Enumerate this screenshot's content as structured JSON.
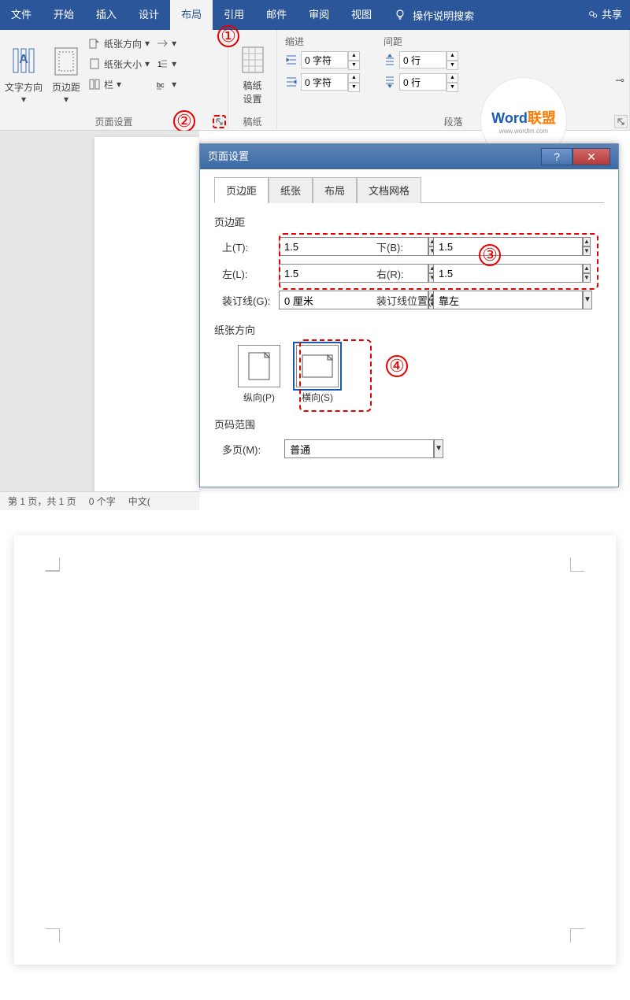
{
  "ribbon": {
    "tabs": [
      "文件",
      "开始",
      "插入",
      "设计",
      "布局",
      "引用",
      "邮件",
      "审阅",
      "视图"
    ],
    "active_index": 4,
    "tell_me": "操作说明搜索",
    "share": "共享"
  },
  "groups": {
    "page_setup": {
      "text_direction": "文字方向",
      "margins": "页边距",
      "orientation": "纸张方向",
      "size": "纸张大小",
      "columns": "栏",
      "breaks": "",
      "line_numbers": "",
      "hyphenation": "",
      "label": "页面设置"
    },
    "manuscript": {
      "btn": "稿纸\n设置",
      "label": "稿纸"
    },
    "paragraph": {
      "label": "段落",
      "indent_label": "缩进",
      "spacing_label": "间距",
      "indent_left": "0 字符",
      "indent_right": "0 字符",
      "spacing_before": "0 行",
      "spacing_after": "0 行"
    }
  },
  "dialog": {
    "title": "页面设置",
    "tabs": [
      "页边距",
      "纸张",
      "布局",
      "文档网格"
    ],
    "active_tab": 0,
    "section_margins": "页边距",
    "top_label": "上(T):",
    "top_val": "1.5",
    "bottom_label": "下(B):",
    "bottom_val": "1.5",
    "left_label": "左(L):",
    "left_val": "1.5",
    "right_label": "右(R):",
    "right_val": "1.5",
    "gutter_label": "装订线(G):",
    "gutter_val": "0 厘米",
    "gutter_pos_label": "装订线位置(U):",
    "gutter_pos_val": "靠左",
    "section_orient": "纸张方向",
    "portrait": "纵向(P)",
    "landscape": "横向(S)",
    "section_pages": "页码范围",
    "multipage_label": "多页(M):",
    "multipage_val": "普通"
  },
  "callouts": {
    "c1": "①",
    "c2": "②",
    "c3": "③",
    "c4": "④"
  },
  "status": {
    "pages": "第 1 页，共 1 页",
    "words": "0 个字",
    "lang": "中文("
  },
  "watermark": {
    "p1": "Word",
    "p2": "联盟",
    "url": "www.wordlm.com"
  }
}
